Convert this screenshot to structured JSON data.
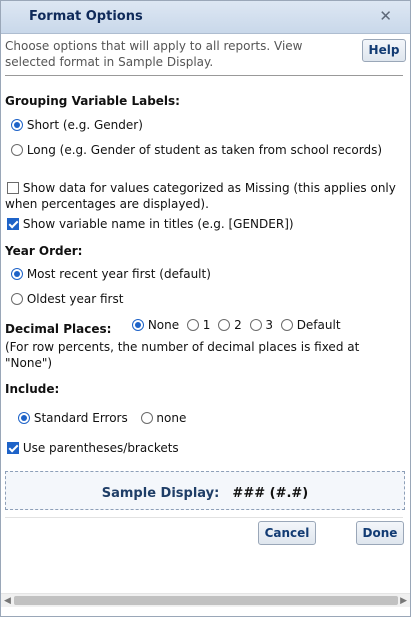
{
  "window": {
    "title": "Format Options",
    "close_label": "✕"
  },
  "intro": "Choose options that will apply to all reports. View selected format in Sample Display.",
  "help_button": "Help",
  "grouping": {
    "heading": "Grouping Variable Labels:",
    "short_label": "Short (e.g. Gender)",
    "long_label": "Long (e.g. Gender of student as taken from school records)",
    "selected": "short"
  },
  "missing": {
    "label_line1": "Show data for values categorized as Missing (this applies only",
    "label_line2": "when percentages are displayed).",
    "checked": false
  },
  "varname": {
    "label": "Show variable name in titles (e.g. [GENDER])",
    "checked": true
  },
  "year_order": {
    "heading": "Year Order:",
    "recent_label": "Most recent year first (default)",
    "oldest_label": "Oldest year first",
    "selected": "recent"
  },
  "decimal": {
    "heading": "Decimal Places:",
    "options": [
      "None",
      "1",
      "2",
      "3",
      "Default"
    ],
    "selected": "None",
    "note_line1": "(For row percents, the number of decimal places is fixed at",
    "note_line2": "\"None\")"
  },
  "include": {
    "heading": "Include:",
    "standard_errors_label": "Standard Errors",
    "none_label": "none",
    "selected": "standard_errors"
  },
  "parentheses": {
    "label": "Use parentheses/brackets",
    "checked": true
  },
  "sample": {
    "label": "Sample Display:",
    "value": "### (#.#)"
  },
  "buttons": {
    "cancel": "Cancel",
    "done": "Done"
  },
  "icons": {
    "close": "close-icon"
  },
  "colors": {
    "accent": "#1e63c8",
    "title_text": "#0f2a5a",
    "titlebar": "#c9d8ea"
  }
}
